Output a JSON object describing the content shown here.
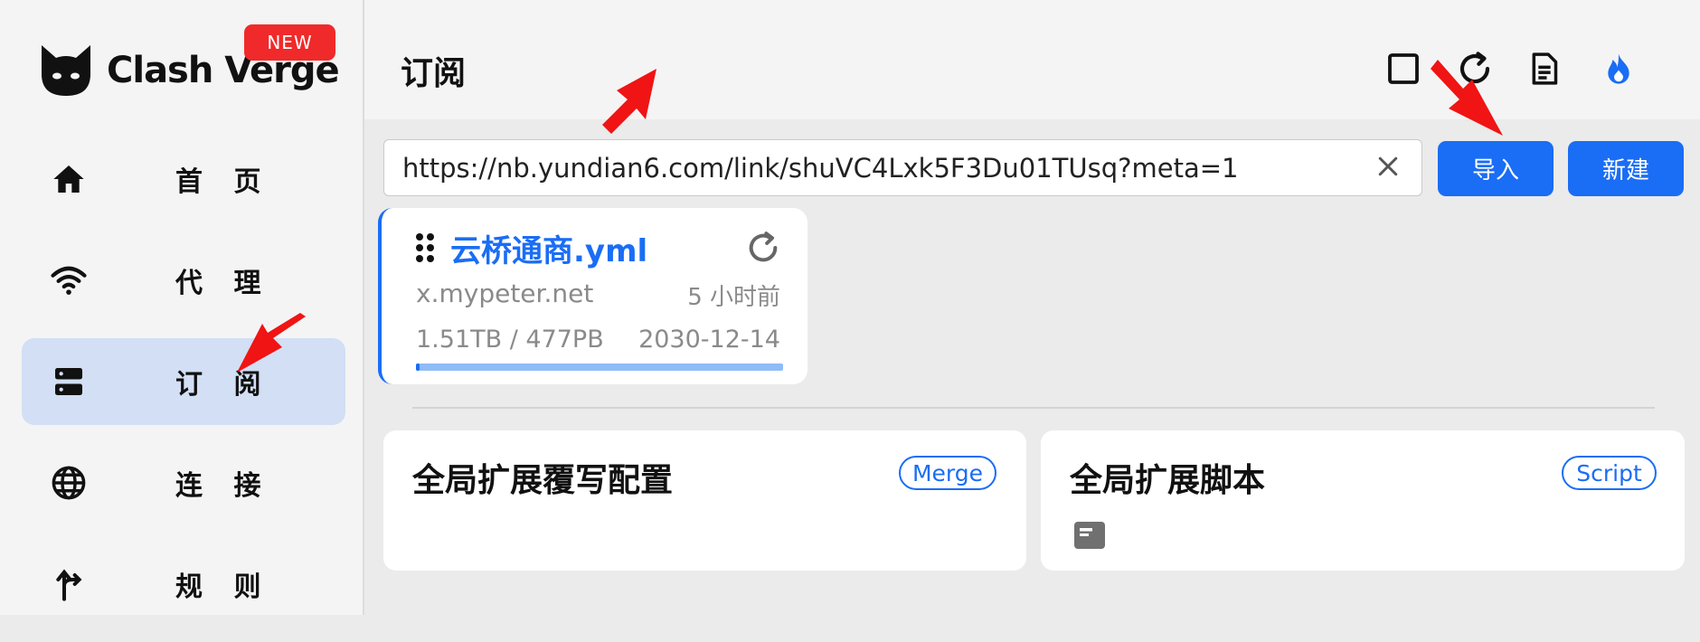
{
  "app": {
    "name": "Clash Verge",
    "badge": "NEW"
  },
  "sidebar": {
    "items": [
      {
        "label": "首 页",
        "icon": "home-icon"
      },
      {
        "label": "代 理",
        "icon": "wifi-icon"
      },
      {
        "label": "订 阅",
        "icon": "server-icon",
        "active": true
      },
      {
        "label": "连 接",
        "icon": "globe-icon"
      },
      {
        "label": "规 则",
        "icon": "route-icon"
      }
    ]
  },
  "header": {
    "title": "订阅",
    "icons": [
      "square-icon",
      "refresh-icon",
      "document-icon",
      "flame-icon"
    ]
  },
  "import": {
    "url_value": "https://nb.yundian6.com/link/shuVC4Lxk5F3Du01TUsq?meta=1",
    "import_label": "导入",
    "new_label": "新建"
  },
  "profile": {
    "name": "云桥通商.yml",
    "host": "x.mypeter.net",
    "updated": "5 小时前",
    "usage": "1.51TB / 477PB",
    "expire": "2030-12-14",
    "progress": 0.01
  },
  "extensions": [
    {
      "title": "全局扩展覆写配置",
      "badge": "Merge"
    },
    {
      "title": "全局扩展脚本",
      "badge": "Script"
    }
  ],
  "colors": {
    "accent": "#1a6df5",
    "badge_red": "#f02a2a",
    "active_nav": "#d2dff4",
    "arrow": "#f01414"
  }
}
